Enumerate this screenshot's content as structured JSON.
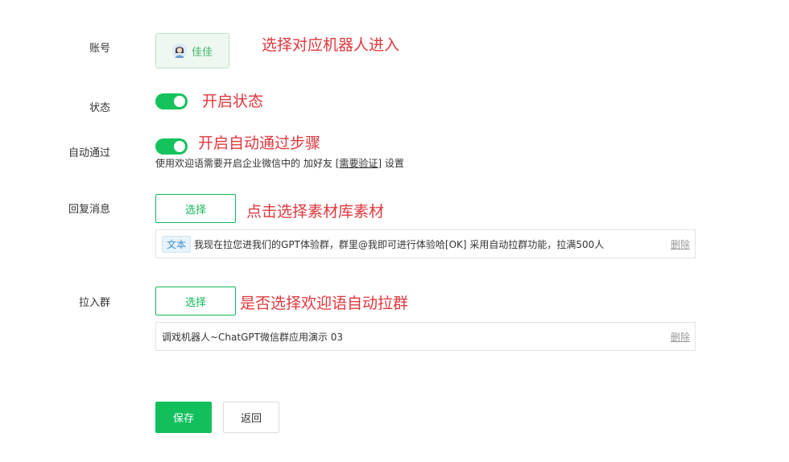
{
  "form": {
    "account": {
      "label": "账号",
      "value": "佳佳",
      "icon": "avatar-icon"
    },
    "status": {
      "label": "状态",
      "enabled": true
    },
    "auto_pass": {
      "label": "自动通过",
      "enabled": true,
      "hint_prefix": "使用欢迎语需要开启企业微信中的 加好友 [",
      "hint_link": "需要验证",
      "hint_suffix": "] 设置"
    },
    "reply": {
      "label": "回复消息",
      "select_label": "选择",
      "item_tag": "文本",
      "item_text": "我现在拉您进我们的GPT体验群，群里@我即可进行体验哈[OK] 采用自动拉群功能，拉满500人",
      "delete_label": "删除"
    },
    "group": {
      "label": "拉入群",
      "select_label": "选择",
      "item_text": "调戏机器人~ChatGPT微信群应用演示 03",
      "delete_label": "删除"
    }
  },
  "annotations": {
    "account": "选择对应机器人进入",
    "status": "开启状态",
    "auto_pass": "开启自动通过步骤",
    "reply": "点击选择素材库素材",
    "group": "是否选择欢迎语自动拉群"
  },
  "actions": {
    "save_label": "保存",
    "back_label": "返回"
  },
  "colors": {
    "primary": "#11c05d",
    "annotation": "#e0383e",
    "tag_blue": "#3b8fd6"
  }
}
